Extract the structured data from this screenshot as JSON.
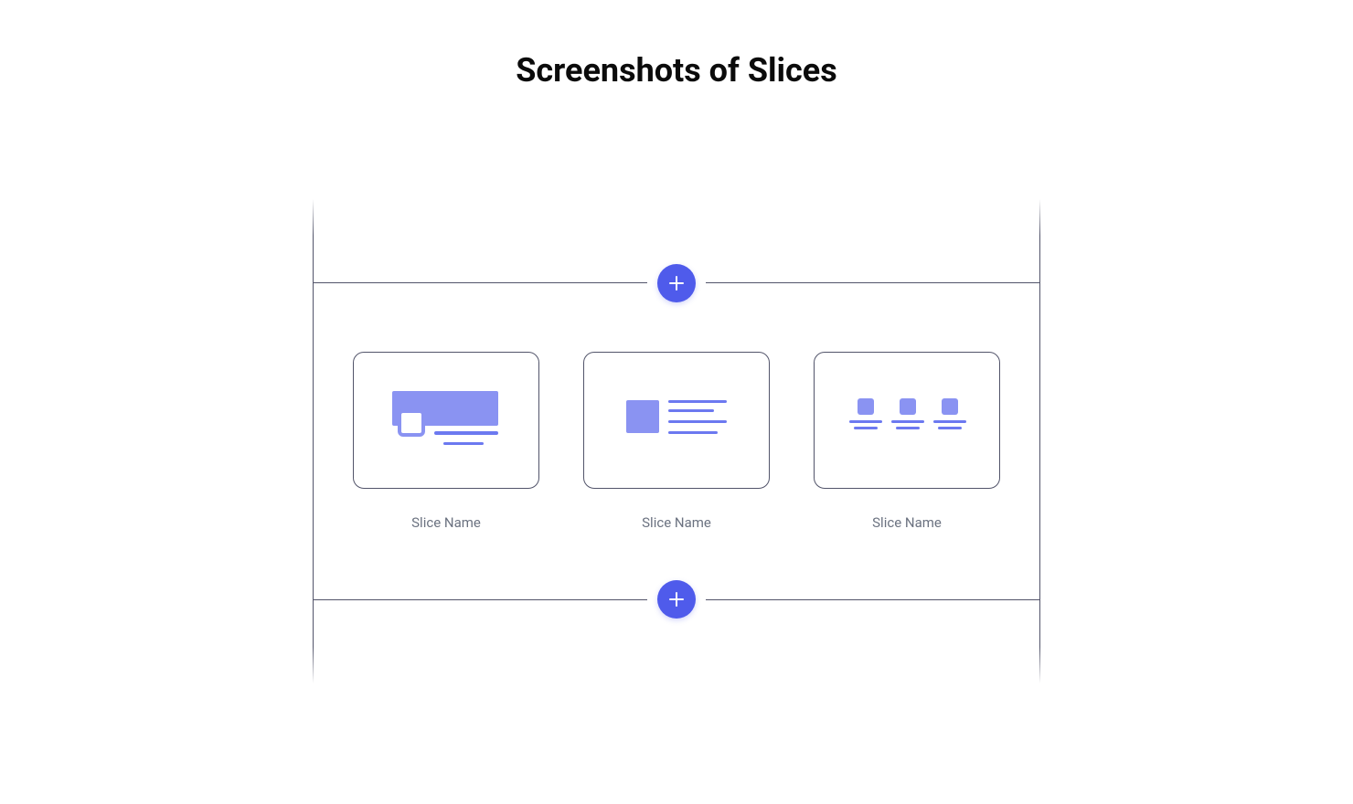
{
  "title": "Screenshots of Slices",
  "slices": [
    {
      "label": "Slice Name"
    },
    {
      "label": "Slice Name"
    },
    {
      "label": "Slice Name"
    }
  ],
  "colors": {
    "accent": "#4F5BEB",
    "mockFill": "#8A93F2",
    "mockLine": "#6C79F0",
    "border": "#52546a",
    "labelText": "#6b7280"
  }
}
